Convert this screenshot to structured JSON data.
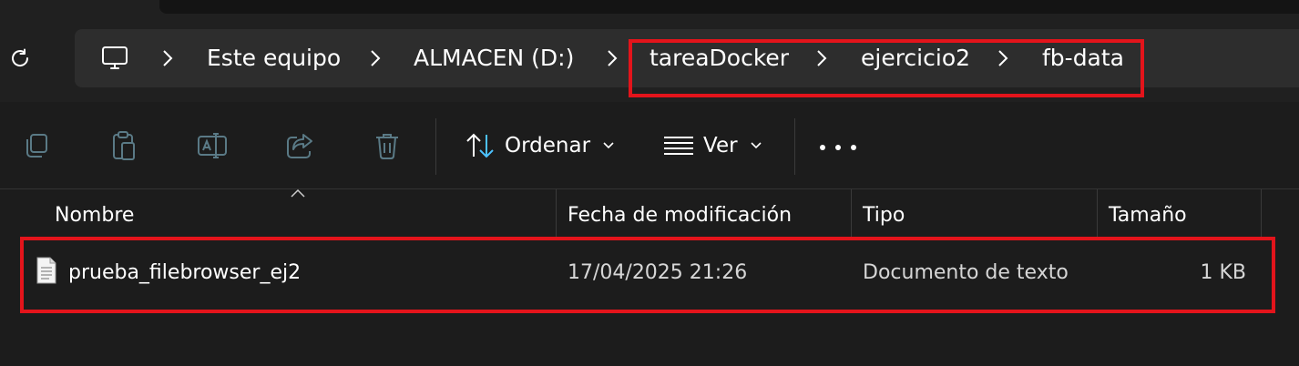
{
  "breadcrumb": {
    "items": [
      {
        "label": "Este equipo"
      },
      {
        "label": "ALMACEN (D:)"
      },
      {
        "label": "tareaDocker"
      },
      {
        "label": "ejercicio2"
      },
      {
        "label": "fb-data"
      }
    ],
    "icons": {
      "root": "computer-icon",
      "separator": "chevron-right-icon",
      "refresh": "refresh-icon"
    }
  },
  "toolbar": {
    "icons": [
      "copy-icon",
      "paste-icon",
      "rename-icon",
      "share-icon",
      "delete-icon"
    ],
    "sort_label": "Ordenar",
    "view_label": "Ver",
    "more_icon": "more-icon"
  },
  "columns": {
    "name": "Nombre",
    "modified": "Fecha de modificación",
    "type": "Tipo",
    "size": "Tamaño"
  },
  "files": [
    {
      "name": "prueba_filebrowser_ej2",
      "modified": "17/04/2025 21:26",
      "type": "Documento de texto",
      "size": "1 KB",
      "icon": "text-file-icon"
    }
  ],
  "colors": {
    "background": "#1c1c1c",
    "address_bar": "#2d2d2d",
    "highlight": "#e3141b",
    "text": "#ffffff",
    "disabled_icon": "#5a7a86"
  }
}
